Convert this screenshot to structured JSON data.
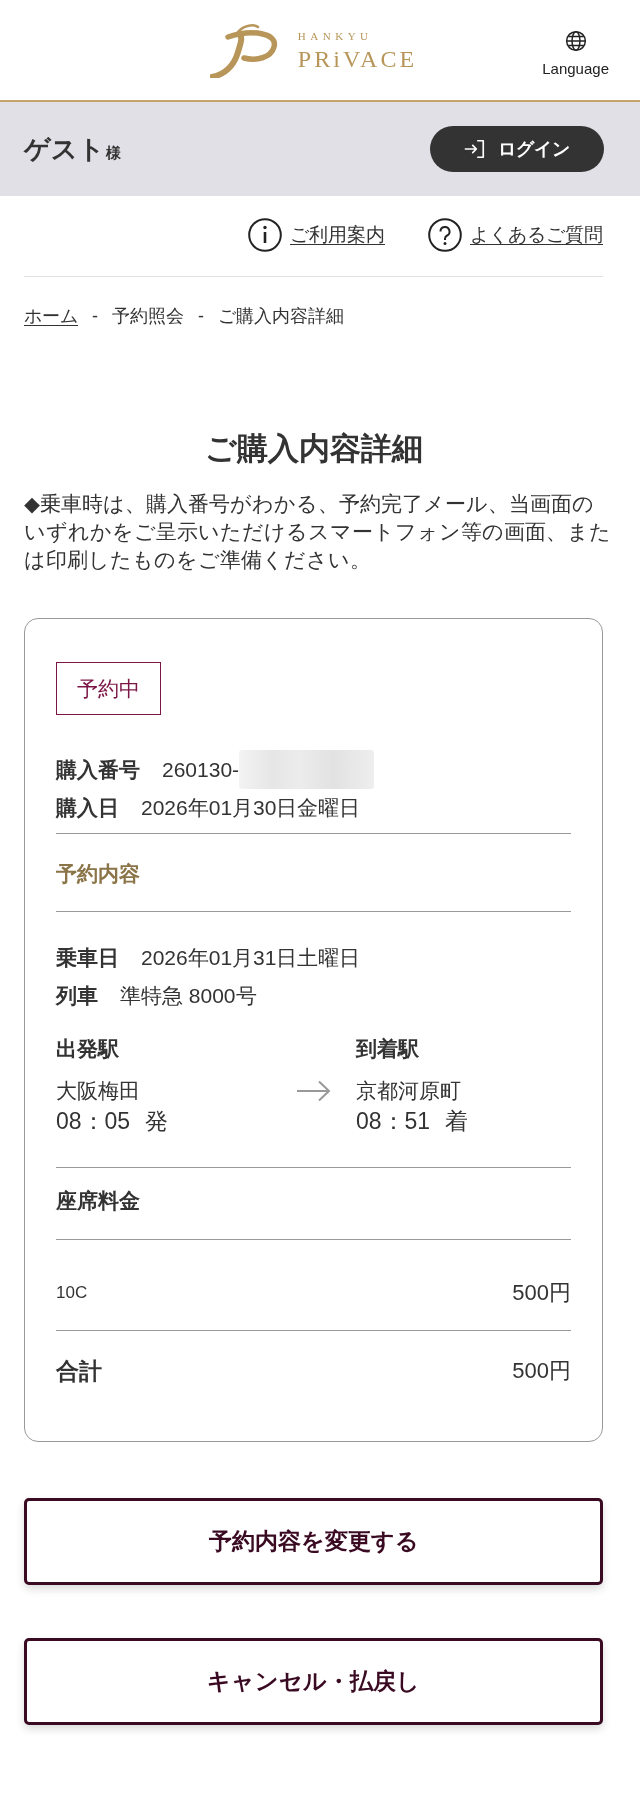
{
  "header": {
    "logo": {
      "brand_top": "HANKYU",
      "brand_name": "PRiVACE"
    },
    "language": {
      "label": "Language"
    }
  },
  "user_bar": {
    "name": "ゲスト",
    "honorific": "様",
    "login_button": {
      "label": "ログイン"
    }
  },
  "help_links": [
    {
      "kind": "info",
      "label": "ご利用案内"
    },
    {
      "kind": "question",
      "label": "よくあるご質問"
    }
  ],
  "breadcrumb": {
    "items": [
      {
        "label": "ホーム",
        "link": true,
        "separator": "-"
      },
      {
        "label": "予約照会",
        "link": false,
        "separator": "-"
      },
      {
        "label": "ご購入内容詳細",
        "link": false
      }
    ]
  },
  "page_title": "ご購入内容詳細",
  "notice": "◆乗車時は、購入番号がわかる、予約完了メール、当画面のいずれかをご呈示いただけるスマートフォン等の画面、または印刷したものをご準備ください。",
  "reservation": {
    "status": {
      "label": "予約中"
    },
    "purchase_number": {
      "label": "購入番号",
      "value": "260130-",
      "redacted": true
    },
    "purchase_date": {
      "label": "購入日",
      "value": "2026年01月30日金曜日"
    },
    "section_title": "予約内容",
    "ride_date": {
      "label": "乗車日",
      "value": "2026年01月31日土曜日"
    },
    "train": {
      "label": "列車",
      "value": "準特急 8000号"
    },
    "departure": {
      "label": "出発駅",
      "station": "大阪梅田",
      "time": "08：05 発"
    },
    "arrival": {
      "label": "到着駅",
      "station": "京都河原町",
      "time": "08：51 着"
    },
    "seat_fee": {
      "title": "座席料金",
      "items": [
        {
          "seat": "10C",
          "price": "500円"
        }
      ]
    },
    "total": {
      "label": "合計",
      "value": "500円"
    }
  },
  "actions": [
    {
      "label": "予約内容を変更する"
    },
    {
      "label": "キャンセル・払戻し"
    }
  ]
}
